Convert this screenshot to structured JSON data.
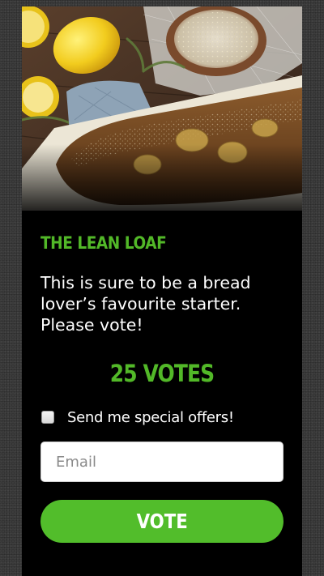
{
  "card": {
    "title": "THE LEAN LOAF",
    "description": "This is sure to be a bread lover’s favourite starter. Please vote!",
    "votes_label": "25 VOTES"
  },
  "form": {
    "offers_label": "Send me special offers!",
    "offers_checked": false,
    "email_placeholder": "Email",
    "email_value": "",
    "vote_label": "VOTE"
  },
  "colors": {
    "accent": "#52b828",
    "button": "#52bd2b",
    "card_background": "#000000",
    "page_background": "#3c3c3c"
  },
  "icons": {
    "hero": "bread-loaf-photo"
  }
}
